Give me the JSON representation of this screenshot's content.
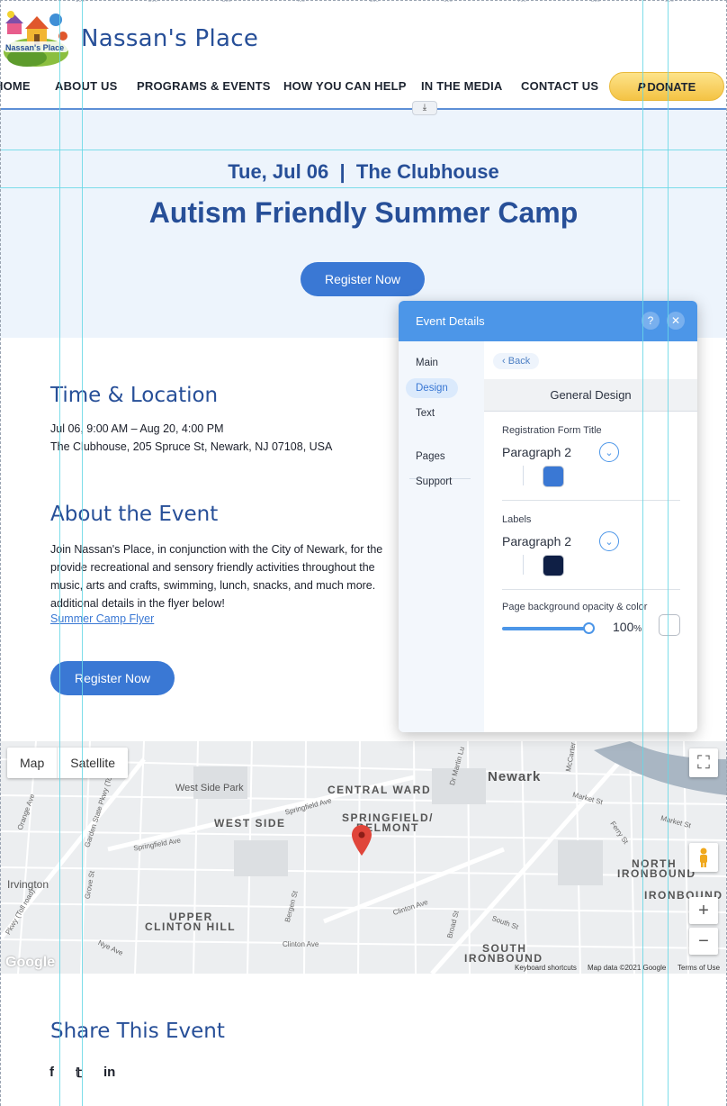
{
  "ruler": {
    "ticks": [
      "100",
      "200",
      "300",
      "400",
      "500",
      "600",
      "700",
      "800",
      "900"
    ]
  },
  "site": {
    "name": "Nassan's Place",
    "logo_text": "Nassan's Place"
  },
  "nav": {
    "items": [
      "HOME",
      "ABOUT US",
      "PROGRAMS & EVENTS",
      "HOW YOU CAN HELP",
      "IN THE MEDIA",
      "CONTACT US"
    ],
    "donate_icon": "P",
    "donate_label": "DONATE"
  },
  "hero": {
    "date_location": "Tue, Jul 06  |  The Clubhouse",
    "title": "Autism Friendly Summer Camp",
    "register_label": "Register Now"
  },
  "time_location": {
    "heading": "Time & Location",
    "dates": "Jul 06, 9:00 AM – Aug 20, 4:00 PM",
    "address": "The Clubhouse, 205 Spruce St, Newark, NJ 07108, USA"
  },
  "about": {
    "heading": "About the Event",
    "body": "Join Nassan's Place, in conjunction with the City of Newark, for the provide recreational and sensory friendly activities throughout the music, arts and crafts, swimming, lunch, snacks, and much more. additional details in the flyer below!",
    "flyer_link": "Summer Camp Flyer",
    "register_label": "Register Now"
  },
  "map": {
    "tabs": [
      "Map",
      "Satellite"
    ],
    "labels": {
      "newark": "Newark",
      "central_ward": "CENTRAL WARD",
      "west_side_park": "West Side Park",
      "west_side": "WEST SIDE",
      "springfield_belmont_1": "SPRINGFIELD/",
      "springfield_belmont_2": "BELMONT",
      "irvington": "Irvington",
      "upper_clinton_1": "UPPER",
      "upper_clinton_2": "CLINTON HILL",
      "north_ironbound_1": "NORTH",
      "north_ironbound_2": "IRONBOUND",
      "ironbound": "IRONBOUND",
      "south_ironbound_1": "SOUTH",
      "south_ironbound_2": "IRONBOUND",
      "springfield_ave": "Springfield Ave",
      "springfield_ave2": "Springfield Ave",
      "clinton_ave": "Clinton Ave",
      "clinton_ave2": "Clinton Ave",
      "market_st": "Market St",
      "market_st2": "Market St",
      "bergen_st": "Bergen St",
      "broad_st": "Broad St",
      "south_st": "South St",
      "nye_ave": "Nye Ave",
      "orange_ave": "Orange Ave",
      "gsp": "Garden State Pkwy (Toll)",
      "ferry_st": "Ferry St",
      "mccarter": "McCarter",
      "mlk": "Dr Martin Lu",
      "toll_road": "Pkwy (Toll road)",
      "grove_st": "Grove St"
    },
    "footer": {
      "google": "Google",
      "shortcuts": "Keyboard shortcuts",
      "map_data": "Map data ©2021 Google",
      "terms": "Terms of Use"
    }
  },
  "share": {
    "heading": "Share This Event",
    "icons": [
      "f",
      "𝕥",
      "in"
    ]
  },
  "panel": {
    "title": "Event Details",
    "help": "?",
    "close": "✕",
    "side_items": [
      "Main",
      "Design",
      "Text",
      "Pages",
      "Support"
    ],
    "back_label": "Back",
    "section_title": "General Design",
    "reg_title_label": "Registration Form Title",
    "reg_title_font": "Paragraph 2",
    "reg_title_color": "#3a78d4",
    "labels_label": "Labels",
    "labels_font": "Paragraph 2",
    "labels_color": "#0f1f45",
    "opacity_label": "Page background opacity & color",
    "opacity_value": "100",
    "opacity_unit": "%",
    "opacity_level": 1.0
  },
  "colors": {
    "brand_blue": "#274f98",
    "accent_blue": "#3a78d4",
    "panel_blue": "#4c96e8",
    "donate_gold": "#f4c344",
    "hero_bg": "#edf4fc",
    "guide_cyan": "#67d7e5"
  }
}
